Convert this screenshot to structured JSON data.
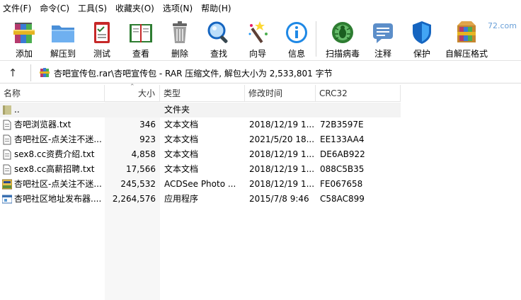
{
  "menu": [
    "文件(F)",
    "命令(C)",
    "工具(S)",
    "收藏夹(O)",
    "选项(N)",
    "帮助(H)"
  ],
  "toolbar": {
    "buttons": [
      {
        "label": "添加",
        "icon": "books-add-icon"
      },
      {
        "label": "解压到",
        "icon": "folder-extract-icon"
      },
      {
        "label": "测试",
        "icon": "checklist-test-icon"
      },
      {
        "label": "查看",
        "icon": "book-view-icon"
      },
      {
        "label": "删除",
        "icon": "trash-icon"
      },
      {
        "label": "查找",
        "icon": "magnifier-icon"
      },
      {
        "label": "向导",
        "icon": "magic-wand-icon"
      },
      {
        "label": "信息",
        "icon": "info-icon"
      },
      {
        "label": "扫描病毒",
        "icon": "virus-scan-icon"
      },
      {
        "label": "注释",
        "icon": "comment-icon"
      },
      {
        "label": "保护",
        "icon": "shield-icon"
      },
      {
        "label": "自解压格式",
        "icon": "sfx-box-icon"
      }
    ],
    "watermark": "72.com"
  },
  "address": {
    "up_icon": "up-arrow-icon",
    "text": "杏吧宣传包.rar\\杏吧宣传包 - RAR 压缩文件, 解包大小为 2,533,801 字节"
  },
  "columns": {
    "name": "名称",
    "size": "大小",
    "type": "类型",
    "date": "修改时间",
    "crc": "CRC32"
  },
  "files": [
    {
      "name": "..",
      "size": "",
      "type": "文件夹",
      "date": "",
      "crc": "",
      "icon": "folder-up-icon"
    },
    {
      "name": "杏吧浏览器.txt",
      "size": "346",
      "type": "文本文档",
      "date": "2018/12/19 1...",
      "crc": "72B3597E",
      "icon": "text-file-icon"
    },
    {
      "name": "杏吧社区-点关注不迷...",
      "size": "923",
      "type": "文本文档",
      "date": "2021/5/20 18...",
      "crc": "EE133AA4",
      "icon": "text-file-icon"
    },
    {
      "name": "sex8.cc资费介绍.txt",
      "size": "4,858",
      "type": "文本文档",
      "date": "2018/12/19 1...",
      "crc": "DE6AB922",
      "icon": "text-file-icon"
    },
    {
      "name": "sex8.cc高薪招聘.txt",
      "size": "17,566",
      "type": "文本文档",
      "date": "2018/12/19 1...",
      "crc": "088C5B35",
      "icon": "text-file-icon"
    },
    {
      "name": "杏吧社区-点关注不迷...",
      "size": "245,532",
      "type": "ACDSee Photo ...",
      "date": "2018/12/19 1...",
      "crc": "FE067658",
      "icon": "jpeg-file-icon"
    },
    {
      "name": "杏吧社区地址发布器....",
      "size": "2,264,576",
      "type": "应用程序",
      "date": "2015/7/8 9:46",
      "crc": "C58AC899",
      "icon": "exe-file-icon"
    }
  ]
}
